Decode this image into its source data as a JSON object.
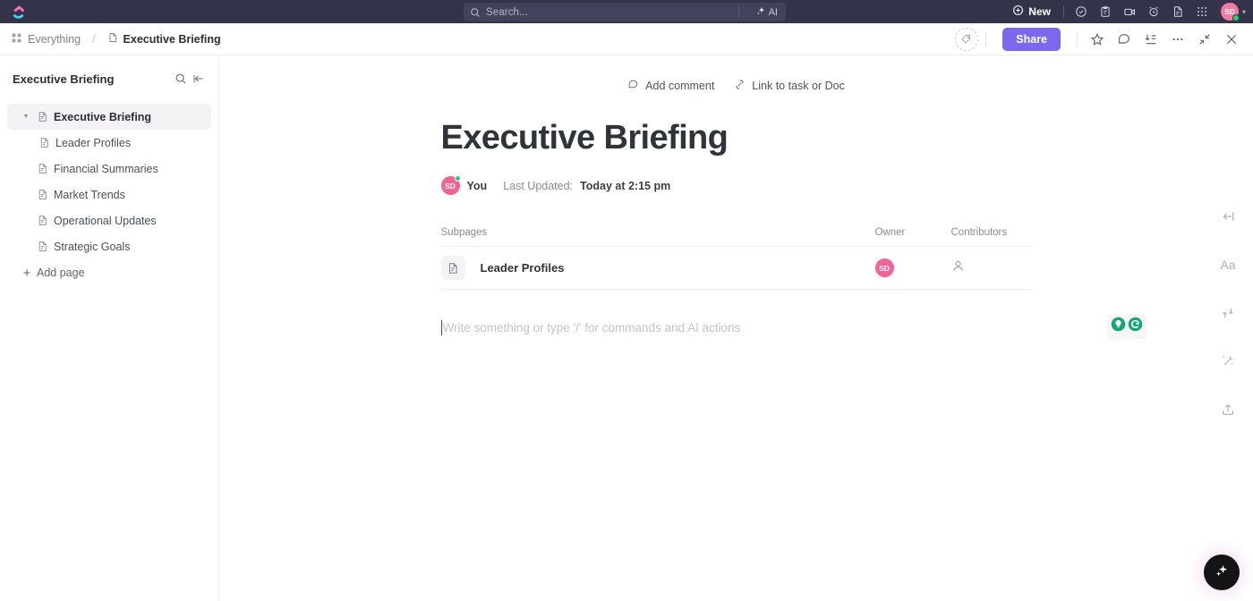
{
  "topbar": {
    "logo_icon": "clickup-logo-icon",
    "search": {
      "placeholder": "Search...",
      "icon": "search-icon"
    },
    "ai_label": "AI",
    "ai_icon": "sparkle-icon",
    "new_label": "New",
    "new_icon": "plus-circle-icon",
    "icons": [
      {
        "name": "check-circle-icon"
      },
      {
        "name": "clipboard-icon"
      },
      {
        "name": "video-camera-icon"
      },
      {
        "name": "alarm-clock-icon"
      },
      {
        "name": "document-icon"
      },
      {
        "name": "apps-grid-icon"
      }
    ],
    "avatar": {
      "initials": "SD",
      "status": "online",
      "color": "#f27ba6"
    },
    "chevron_icon": "chevron-down-icon"
  },
  "breadcrumb": {
    "grid_icon": "grid-icon",
    "root": "Everything",
    "separator": "/",
    "doc_icon": "document-icon",
    "current": "Executive Briefing"
  },
  "header_actions": {
    "tag_icon": "tag-icon",
    "share_label": "Share",
    "share_color": "#7b68ee",
    "icons": [
      {
        "name": "star-icon"
      },
      {
        "name": "comment-icon"
      },
      {
        "name": "download-icon"
      },
      {
        "name": "more-options-icon"
      },
      {
        "name": "collapse-icon"
      },
      {
        "name": "close-icon"
      }
    ]
  },
  "sidebar": {
    "title": "Executive Briefing",
    "search_icon": "search-icon",
    "collapse_icon": "collapse-sidebar-icon",
    "items": [
      {
        "label": "Executive Briefing",
        "level": 0,
        "selected": true,
        "expanded": true,
        "icon": "document-icon"
      },
      {
        "label": "Leader Profiles",
        "level": 1,
        "selected": false,
        "icon": "document-icon"
      },
      {
        "label": "Financial Summaries",
        "level": 0,
        "selected": false,
        "icon": "document-icon"
      },
      {
        "label": "Market Trends",
        "level": 0,
        "selected": false,
        "icon": "document-icon"
      },
      {
        "label": "Operational Updates",
        "level": 0,
        "selected": false,
        "icon": "document-icon"
      },
      {
        "label": "Strategic Goals",
        "level": 0,
        "selected": false,
        "icon": "document-icon"
      }
    ],
    "add_page_label": "Add page",
    "add_page_icon": "plus-icon"
  },
  "doc": {
    "add_comment_label": "Add comment",
    "add_comment_icon": "comment-icon",
    "link_label": "Link to task or Doc",
    "link_icon": "link-icon",
    "title": "Executive Briefing",
    "author_avatar": "SD",
    "author_label": "You",
    "updated_label": "Last Updated:",
    "updated_value": "Today at 2:15 pm",
    "subpages": {
      "columns": [
        "Subpages",
        "Owner",
        "Contributors"
      ],
      "rows": [
        {
          "name": "Leader Profiles",
          "icon": "document-icon",
          "owner": "SD",
          "contributors_icon": "person-icon"
        }
      ]
    },
    "editor_placeholder": "Write something or type '/' for commands and AI actions",
    "grammarly": {
      "idea_icon": "lightbulb-icon",
      "logo_icon": "grammarly-logo-icon",
      "color": "#15a67a"
    }
  },
  "rail": {
    "icons": [
      {
        "name": "collapse-left-icon"
      },
      {
        "name": "font-size-icon",
        "label": "Aa"
      },
      {
        "name": "relationship-icon"
      },
      {
        "name": "magic-wand-icon"
      },
      {
        "name": "share-export-icon"
      }
    ]
  },
  "fab": {
    "icon": "ai-sparkle-icon"
  }
}
